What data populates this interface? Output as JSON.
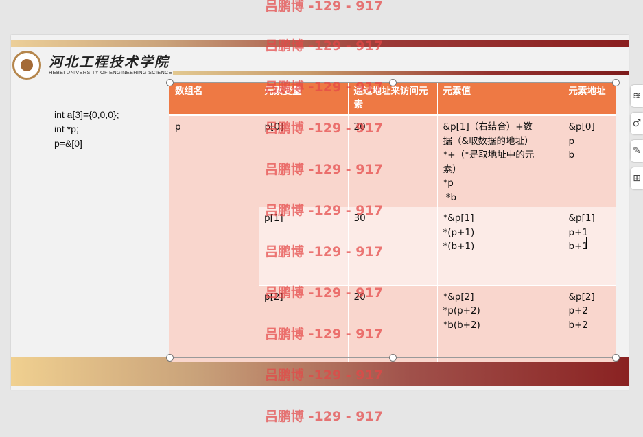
{
  "slide": {
    "logo": {
      "chinese_name": "河北工程技术学院",
      "english_name": "HEBEI UNIVERSITY OF ENGINEERING SCIENCE"
    },
    "code_lines": [
      "int a[3]={0,0,0};",
      "int *p;",
      "p=&[0]"
    ],
    "table": {
      "headers": [
        "数组名",
        "元素变量",
        "通过地址来访问元素",
        "元素值",
        "元素地址"
      ],
      "array_name": "p",
      "rows": [
        {
          "element": "p[0]",
          "access": "20",
          "value_lines": [
            "&p[1]（右结合）+数",
            "据（&取数据的地址）",
            "*+（*是取地址中的元",
            "素）",
            "*p",
            " *b"
          ],
          "address_lines": [
            "&p[0]",
            "p",
            "b"
          ]
        },
        {
          "element": "p[1]",
          "access": "30",
          "value_lines": [
            "*&p[1]",
            "*(p+1)",
            "*(b+1)"
          ],
          "address_lines": [
            "&p[1]",
            "p+1",
            "b+1"
          ]
        },
        {
          "element": "p[2]",
          "access": "20",
          "value_lines": [
            "*&p[2]",
            "*p(p+2)",
            "*b(b+2)"
          ],
          "address_lines": [
            "&p[2]",
            "p+2",
            "b+2"
          ]
        }
      ]
    }
  },
  "watermark": "吕鹏博 -129 - 917",
  "side_toolbar": [
    {
      "icon": "layers-icon",
      "glyph": "≋"
    },
    {
      "icon": "brush-icon",
      "glyph": "♂"
    },
    {
      "icon": "pen-icon",
      "glyph": "✎"
    },
    {
      "icon": "layout-icon",
      "glyph": "⊞"
    }
  ],
  "colors": {
    "header": "#ee7944",
    "row_dark": "#f9d6cd",
    "row_light": "#fcebe7",
    "watermark": "#e44646"
  }
}
